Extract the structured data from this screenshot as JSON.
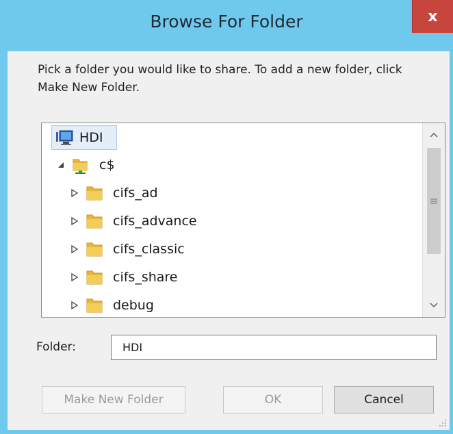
{
  "dialog": {
    "title": "Browse For Folder",
    "close_glyph": "x",
    "instructions": "Pick a folder you would like to share. To add a new folder, click Make New Folder."
  },
  "tree": {
    "root": {
      "label": "HDI",
      "icon": "computer-icon"
    },
    "share": {
      "label": "c$",
      "icon": "network-share-icon",
      "expander": "expanded"
    },
    "folders": [
      {
        "label": "cifs_ad",
        "icon": "folder-icon",
        "expander": "collapsed"
      },
      {
        "label": "cifs_advance",
        "icon": "folder-icon",
        "expander": "collapsed"
      },
      {
        "label": "cifs_classic",
        "icon": "folder-icon",
        "expander": "collapsed"
      },
      {
        "label": "cifs_share",
        "icon": "folder-icon",
        "expander": "collapsed"
      },
      {
        "label": "debug",
        "icon": "folder-icon",
        "expander": "collapsed"
      }
    ],
    "scroll_position": 0.0
  },
  "folder_field": {
    "label": "Folder:",
    "value": "HDI"
  },
  "buttons": {
    "make_new_folder": "Make New Folder",
    "ok": "OK",
    "cancel": "Cancel"
  },
  "colors": {
    "frame": "#6fc9ec",
    "close": "#c8453e",
    "client": "#f0f0f0",
    "folder": "#e8b73a"
  }
}
